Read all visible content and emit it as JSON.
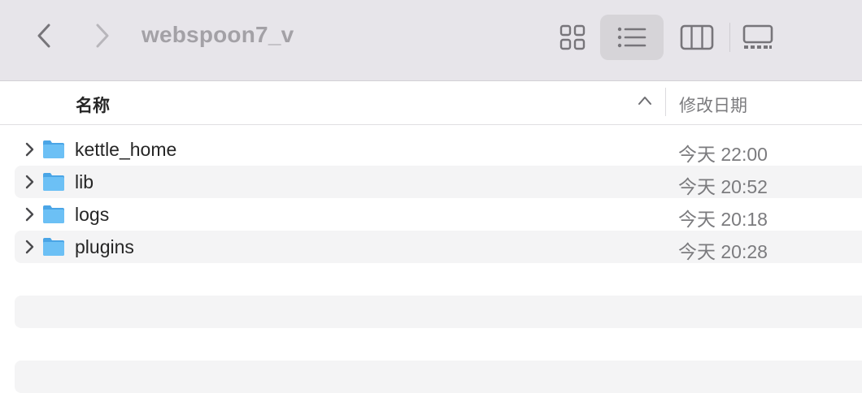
{
  "window": {
    "title": "webspoon7_v"
  },
  "toolbar": {
    "back_icon": "chevron-left-icon",
    "forward_icon": "chevron-right-icon",
    "view_modes": [
      "icons-view-icon",
      "list-view-icon",
      "columns-view-icon",
      "gallery-view-icon"
    ],
    "active_view": "list-view-icon"
  },
  "table": {
    "columns": {
      "name": "名称",
      "modified": "修改日期"
    },
    "sort_icon": "chevron-up-icon",
    "rows": [
      {
        "name": "kettle_home",
        "modified": "今天 22:00"
      },
      {
        "name": "lib",
        "modified": "今天 20:52"
      },
      {
        "name": "logs",
        "modified": "今天 20:18"
      },
      {
        "name": "plugins",
        "modified": "今天 20:28"
      }
    ]
  },
  "colors": {
    "toolbar_bg": "#e7e5ea",
    "row_alt_bg": "#f4f4f5",
    "folder_blue": "#5ab4ef"
  }
}
